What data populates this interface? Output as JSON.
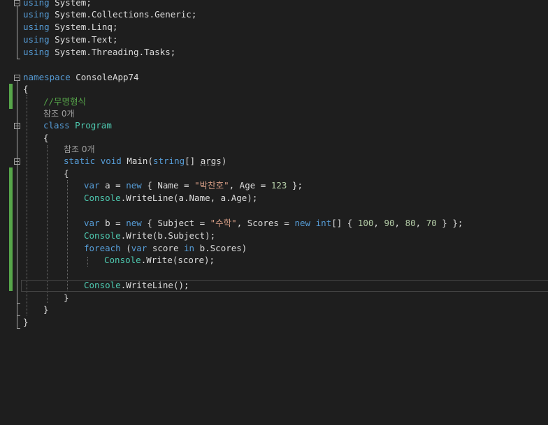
{
  "code": {
    "l1": {
      "kw": "using",
      "rest": " System;"
    },
    "l2": {
      "kw": "using",
      "rest": " System.Collections.Generic;"
    },
    "l3": {
      "kw": "using",
      "rest": " System.Linq;"
    },
    "l4": {
      "kw": "using",
      "rest": " System.Text;"
    },
    "l5": {
      "kw": "using",
      "rest": " System.Threading.Tasks;"
    },
    "ns": {
      "kw": "namespace",
      "name": " ConsoleApp74"
    },
    "brace_open": "{",
    "brace_close": "}",
    "comment": "//무명형식",
    "lens_class": "참조 0개",
    "cls": {
      "kw": "class",
      "name": "Program"
    },
    "lens_main": "참조 0개",
    "main": {
      "kw1": "static",
      "kw2": "void",
      "name": "Main(",
      "kw3": "string",
      "rest1": "[] ",
      "args": "args",
      "rest2": ")"
    },
    "a_decl": {
      "kw1": "var",
      "p1": " a = ",
      "kw2": "new",
      "p2": " { Name = ",
      "str": "\"박찬호\"",
      "p3": ", Age = ",
      "num": "123",
      "p4": " };"
    },
    "a_print": {
      "ty": "Console",
      "rest": ".WriteLine(a.Name, a.Age);"
    },
    "b_decl": {
      "kw1": "var",
      "p1": " b = ",
      "kw2": "new",
      "p2": " { Subject = ",
      "str": "\"수학\"",
      "p3": ", Scores = ",
      "kw3": "new",
      "kw4": "int",
      "p4": "[] { ",
      "n1": "100",
      "c1": ", ",
      "n2": "90",
      "c2": ", ",
      "n3": "80",
      "c3": ", ",
      "n4": "70",
      "p5": " } };"
    },
    "b_print": {
      "ty": "Console",
      "rest": ".Write(b.Subject);"
    },
    "foreach": {
      "kw1": "foreach",
      "p1": " (",
      "kw2": "var",
      "p2": " score ",
      "kw3": "in",
      "p3": " b.Scores)"
    },
    "score_print": {
      "ty": "Console",
      "rest": ".Write(score);"
    },
    "writeline": {
      "ty": "Console",
      "rest": ".WriteLine();"
    }
  },
  "colors": {
    "background": "#1e1e1e",
    "keyword": "#569cd6",
    "type": "#4ec9b0",
    "string": "#d69d85",
    "number": "#b5cea8",
    "comment": "#57a64a",
    "change_bar": "#57a64a"
  },
  "icons": [
    "collapse-icon"
  ]
}
